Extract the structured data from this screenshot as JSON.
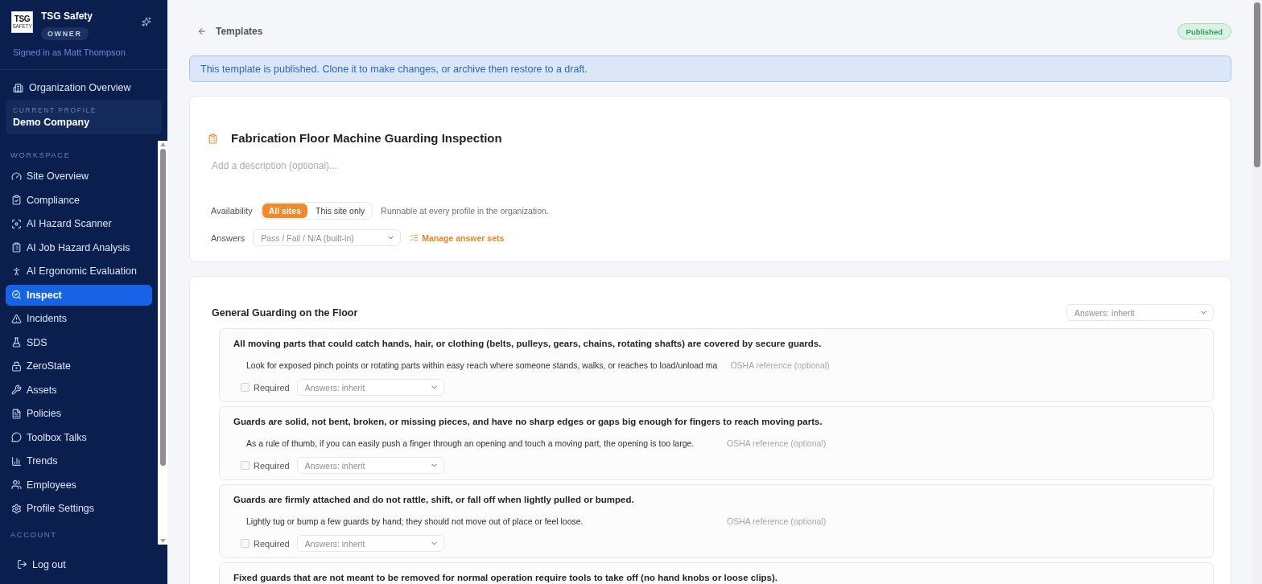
{
  "sidebar": {
    "logo": {
      "wordmark": "TSG",
      "tagline": "SAFETY"
    },
    "org_name": "TSG Safety",
    "role_badge": "OWNER",
    "signed_in": "Signed in as Matt Thompson",
    "org_overview": "Organization Overview",
    "current_profile": {
      "label": "CURRENT PROFILE",
      "name": "Demo Company"
    },
    "sections": [
      {
        "label": "WORKSPACE",
        "items": [
          {
            "label": "Site Overview",
            "selected": false
          },
          {
            "label": "Compliance",
            "selected": false
          },
          {
            "label": "AI Hazard Scanner",
            "selected": false
          },
          {
            "label": "AI Job Hazard Analysis",
            "selected": false
          },
          {
            "label": "AI Ergonomic Evaluation",
            "selected": false
          },
          {
            "label": "Inspect",
            "selected": true
          },
          {
            "label": "Incidents",
            "selected": false
          },
          {
            "label": "SDS",
            "selected": false
          },
          {
            "label": "ZeroState",
            "selected": false
          },
          {
            "label": "Assets",
            "selected": false
          },
          {
            "label": "Policies",
            "selected": false
          },
          {
            "label": "Toolbox Talks",
            "selected": false
          },
          {
            "label": "Trends",
            "selected": false
          },
          {
            "label": "Employees",
            "selected": false
          },
          {
            "label": "Profile Settings",
            "selected": false
          }
        ]
      },
      {
        "label": "ACCOUNT"
      }
    ],
    "logout": "Log out"
  },
  "header": {
    "back_label": "Templates",
    "status_badge": "Published"
  },
  "banner": "This template is published. Clone it to make changes, or archive then restore to a draft.",
  "template": {
    "title": "Fabrication Floor Machine Guarding Inspection",
    "description_placeholder": "Add a description (optional)...",
    "availability": {
      "label": "Availability",
      "options": [
        {
          "label": "All sites",
          "selected": true
        },
        {
          "label": "This site only",
          "selected": false
        }
      ],
      "hint": "Runnable at every profile in the organization."
    },
    "answers": {
      "label": "Answers",
      "value": "Pass / Fail / N/A (built-in)",
      "manage_link": "Manage answer sets"
    }
  },
  "sections": [
    {
      "title": "General Guarding on the Floor",
      "answers_select": "Answers: inherit",
      "questions": [
        {
          "text": "All moving parts that could catch hands, hair, or clothing (belts, pulleys, gears, chains, rotating shafts) are covered by secure guards.",
          "guidance": "Look for exposed pinch points or rotating parts within easy reach where someone stands, walks, or reaches to load/unload ma",
          "osha_placeholder": "OSHA reference (optional)",
          "required": {
            "label": "Required",
            "checked": false
          },
          "answers_select": "Answers: inherit"
        },
        {
          "text": "Guards are solid, not bent, broken, or missing pieces, and have no sharp edges or gaps big enough for fingers to reach moving parts.",
          "guidance": "As a rule of thumb, if you can easily push a finger through an opening and touch a moving part, the opening is too large.",
          "osha_placeholder": "OSHA reference (optional)",
          "required": {
            "label": "Required",
            "checked": false
          },
          "answers_select": "Answers: inherit"
        },
        {
          "text": "Guards are firmly attached and do not rattle, shift, or fall off when lightly pulled or bumped.",
          "guidance": "Lightly tug or bump a few guards by hand; they should not move out of place or feel loose.",
          "osha_placeholder": "OSHA reference (optional)",
          "required": {
            "label": "Required",
            "checked": false
          },
          "answers_select": "Answers: inherit"
        },
        {
          "text": "Fixed guards that are not meant to be removed for normal operation require tools to take off (no hand knobs or loose clips)."
        }
      ]
    }
  ]
}
